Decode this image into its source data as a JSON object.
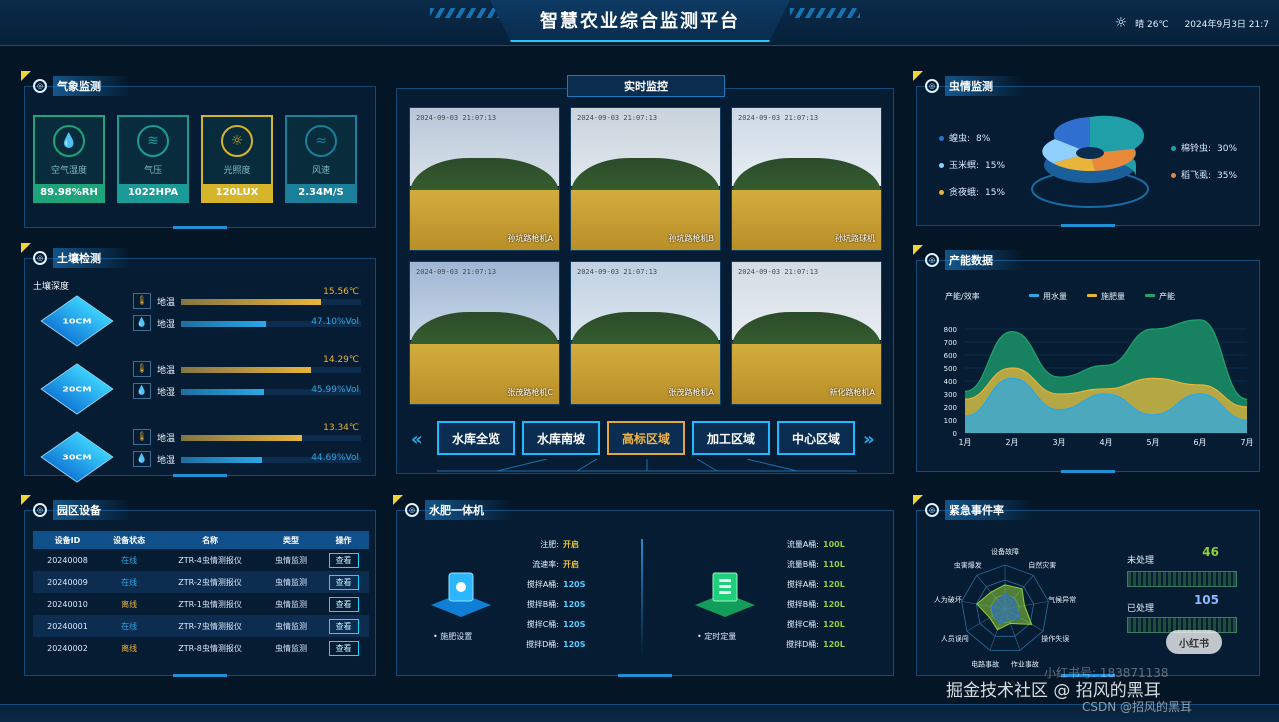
{
  "header": {
    "title": "智慧农业综合监测平台",
    "weather": "晴 26℃",
    "datetime": "2024年9月3日 21:7"
  },
  "weather_panel": {
    "title": "气象监测",
    "cards": [
      {
        "name": "空气湿度",
        "value": "89.98%RH",
        "icon": "droplet-icon",
        "color": "#1ea37a"
      },
      {
        "name": "气压",
        "value": "1022HPA",
        "icon": "pressure-icon",
        "color": "#1a9b98"
      },
      {
        "name": "光照度",
        "value": "120LUX",
        "icon": "sun-icon",
        "color": "#d6b52a"
      },
      {
        "name": "风速",
        "value": "2.34M/S",
        "icon": "wind-icon",
        "color": "#1a7f9b"
      }
    ]
  },
  "soil_panel": {
    "title": "土壤检测",
    "depth_label": "土壤深度",
    "rows": [
      {
        "depth": "10CM",
        "temp_label": "地温",
        "temp": "15.56℃",
        "temp_frac": 0.78,
        "moist_label": "地湿",
        "moist": "47.10%Vol",
        "moist_frac": 0.47
      },
      {
        "depth": "20CM",
        "temp_label": "地温",
        "temp": "14.29℃",
        "temp_frac": 0.72,
        "moist_label": "地湿",
        "moist": "45.99%Vol",
        "moist_frac": 0.46
      },
      {
        "depth": "30CM",
        "temp_label": "地温",
        "temp": "13.34℃",
        "temp_frac": 0.67,
        "moist_label": "地湿",
        "moist": "44.69%Vol",
        "moist_frac": 0.45
      }
    ]
  },
  "device_panel": {
    "title": "园区设备",
    "columns": [
      "设备ID",
      "设备状态",
      "名称",
      "类型",
      "操作"
    ],
    "rows": [
      {
        "id": "20240008",
        "status": "在线",
        "name": "ZTR-4虫情测报仪",
        "type": "虫情监测",
        "action": "查看"
      },
      {
        "id": "20240009",
        "status": "在线",
        "name": "ZTR-2虫情测报仪",
        "type": "虫情监测",
        "action": "查看"
      },
      {
        "id": "20240010",
        "status": "离线",
        "name": "ZTR-1虫情测报仪",
        "type": "虫情监测",
        "action": "查看"
      },
      {
        "id": "20240001",
        "status": "在线",
        "name": "ZTR-7虫情测报仪",
        "type": "虫情监测",
        "action": "查看"
      },
      {
        "id": "20240002",
        "status": "离线",
        "name": "ZTR-8虫情测报仪",
        "type": "虫情监测",
        "action": "查看"
      }
    ]
  },
  "monitor_panel": {
    "title": "实时监控",
    "cameras": [
      {
        "timestamp": "2024-09-03 21:07:13",
        "caption": "孙坑路枪机A"
      },
      {
        "timestamp": "2024-09-03 21:07:13",
        "caption": "孙坑路枪机B"
      },
      {
        "timestamp": "2024-09-03 21:07:13",
        "caption": "孙坑路球机"
      },
      {
        "timestamp": "2024-09-03 21:07:13",
        "caption": "张茂路枪机C"
      },
      {
        "timestamp": "2024-09-03 21:07:13",
        "caption": "张茂路枪机A"
      },
      {
        "timestamp": "2024-09-03 21:07:13",
        "caption": "新化路枪机A"
      }
    ],
    "zones": [
      "水库全览",
      "水库南坡",
      "高标区域",
      "加工区域",
      "中心区域"
    ],
    "active_zone": 2
  },
  "fert_panel": {
    "title": "水肥一体机",
    "left_items": [
      {
        "label": "注肥:",
        "value": "开启",
        "color": "#e9c23a"
      },
      {
        "label": "流速率:",
        "value": "开启",
        "color": "#e9c23a"
      },
      {
        "label": "搅拌A桶:",
        "value": "120S",
        "color": "#4fd0ff"
      },
      {
        "label": "搅拌B桶:",
        "value": "120S",
        "color": "#4fd0ff"
      },
      {
        "label": "搅拌C桶:",
        "value": "120S",
        "color": "#4fd0ff"
      },
      {
        "label": "搅拌D桶:",
        "value": "120S",
        "color": "#4fd0ff"
      }
    ],
    "right_items": [
      {
        "label": "流量A桶:",
        "value": "100L"
      },
      {
        "label": "流量B桶:",
        "value": "110L"
      },
      {
        "label": "搅拌A桶:",
        "value": "120L"
      },
      {
        "label": "搅拌B桶:",
        "value": "120L"
      },
      {
        "label": "搅拌C桶:",
        "value": "120L"
      },
      {
        "label": "搅拌D桶:",
        "value": "120L"
      }
    ],
    "left_device": "施肥设置",
    "right_device": "定时定量"
  },
  "pest_panel": {
    "title": "虫情监测",
    "legend_left": [
      {
        "name": "蝗虫:",
        "value": "8%",
        "color": "#2f6fd0"
      },
      {
        "name": "玉米螟:",
        "value": "15%",
        "color": "#8fd0ff"
      },
      {
        "name": "贪夜蛾:",
        "value": "15%",
        "color": "#e9b43a"
      }
    ],
    "legend_right": [
      {
        "name": "棉铃虫:",
        "value": "30%",
        "color": "#1fa0a8"
      },
      {
        "name": "稻飞虱:",
        "value": "35%",
        "color": "#e98a3a"
      }
    ]
  },
  "chart_data": [
    {
      "type": "area",
      "title": "产能数据",
      "ylabel": "产能/效率",
      "categories": [
        "1月",
        "2月",
        "3月",
        "4月",
        "5月",
        "6月",
        "7月"
      ],
      "ylim": [
        0,
        800
      ],
      "yticks": [
        0,
        100,
        200,
        300,
        400,
        500,
        600,
        700,
        800
      ],
      "legend": "top",
      "series": [
        {
          "name": "用水量",
          "color": "#2aa8e6",
          "values": [
            130,
            420,
            180,
            300,
            140,
            300,
            100
          ]
        },
        {
          "name": "施肥量",
          "color": "#e9b43a",
          "values": [
            260,
            500,
            300,
            340,
            420,
            370,
            200
          ]
        },
        {
          "name": "产能",
          "color": "#1fa36f",
          "values": [
            320,
            780,
            430,
            520,
            800,
            870,
            260
          ]
        }
      ]
    },
    {
      "type": "radar",
      "title": "紧急事件率",
      "axes": [
        "设备故障",
        "自然灾害",
        "气候异常",
        "操作失误",
        "作业事故",
        "电路事故",
        "人员误闯",
        "人为破坏",
        "虫害爆发"
      ],
      "series": [
        {
          "name": "",
          "color": "#8fd03a",
          "values": [
            0.55,
            0.6,
            0.45,
            0.7,
            0.35,
            0.5,
            0.4,
            0.65,
            0.5
          ]
        },
        {
          "name": "",
          "color": "#2f6fd0",
          "values": [
            0.35,
            0.3,
            0.25,
            0.4,
            0.25,
            0.35,
            0.3,
            0.3,
            0.25
          ]
        }
      ],
      "counters": [
        {
          "label": "未处理",
          "value": "46",
          "color": "#8fd03a"
        },
        {
          "label": "已处理",
          "value": "105",
          "color": "#8fb9ff"
        }
      ]
    }
  ],
  "watermark": {
    "line1": "掘金技术社区 @ 招风的黑耳",
    "line2": "CSDN @招风的黑耳",
    "line3": "小红书号: 183871138",
    "badge": "小红书"
  }
}
